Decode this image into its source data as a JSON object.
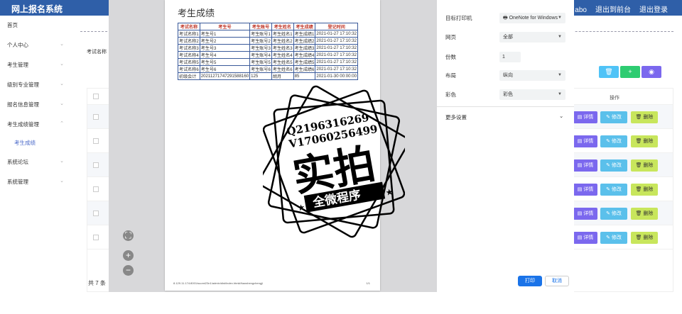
{
  "app": {
    "brand": "网上报名系统",
    "topnav": [
      "理员 abo",
      "退出到前台",
      "退出登录"
    ]
  },
  "sidebar": {
    "items": [
      {
        "label": "首页",
        "arrow": ""
      },
      {
        "label": "个人中心",
        "arrow": "⌄"
      },
      {
        "label": "考生管理",
        "arrow": "⌄"
      },
      {
        "label": "级别专业管理",
        "arrow": "⌄"
      },
      {
        "label": "报名信息管理",
        "arrow": "⌄"
      },
      {
        "label": "考生成绩管理",
        "arrow": "⌃"
      }
    ],
    "sub_item": "考生成绩",
    "items_after": [
      {
        "label": "系统论坛",
        "arrow": "⌄"
      },
      {
        "label": "系统管理",
        "arrow": "⌄"
      }
    ]
  },
  "main": {
    "filter_label": "考试名称",
    "op_header": "操作",
    "total": "共 7 条",
    "action_labels": {
      "detail": "详情",
      "edit": "修改",
      "delete": "删除"
    },
    "row_count": 7,
    "colors": {
      "detail": "#7b68ee",
      "edit": "#5bc0eb",
      "delete": "#c8e65c",
      "danger": "#4fc3f7",
      "add": "#2ecc71",
      "purple": "#7b68ee"
    }
  },
  "preview": {
    "title": "考生成绩",
    "headers": [
      "考试名称",
      "考生号",
      "考生账号",
      "考生姓名",
      "考生成绩",
      "登记时间"
    ],
    "rows": [
      [
        "考试名称1",
        "考生号1",
        "考生账号1",
        "考生姓名1",
        "考生成绩1",
        "2021-01-27 17:10:32"
      ],
      [
        "考试名称2",
        "考生号2",
        "考生账号2",
        "考生姓名2",
        "考生成绩2",
        "2021-01-27 17:10:32"
      ],
      [
        "考试名称3",
        "考生号3",
        "考生账号3",
        "考生姓名3",
        "考生成绩3",
        "2021-01-27 17:10:32"
      ],
      [
        "考试名称4",
        "考生号4",
        "考生账号4",
        "考生姓名4",
        "考生成绩4",
        "2021-01-27 17:10:32"
      ],
      [
        "考试名称5",
        "考生号5",
        "考生账号5",
        "考生姓名5",
        "考生成绩5",
        "2021-01-27 17:10:32"
      ],
      [
        "考试名称6",
        "考生号6",
        "考生账号6",
        "考生姓名6",
        "考生成绩6",
        "2021-01-27 17:10:32"
      ],
      [
        "初级会计",
        "20211271747291588160",
        "125",
        "胡月",
        "85",
        "2021-01-30 00:00:00"
      ]
    ],
    "footer_url": "8.129.11.174:8001/suomi23n1/admin/dist/index.html#/kaoshengchengji",
    "page_num": "1/1"
  },
  "print_panel": {
    "printer_label": "目标打印机",
    "printer_value": "OneNote for Windows",
    "pages_label": "网页",
    "pages_value": "全部",
    "copies_label": "份数",
    "copies_value": "1",
    "layout_label": "布局",
    "layout_value": "纵向",
    "color_label": "彩色",
    "color_value": "彩色",
    "more_label": "更多设置",
    "print_button": "打印",
    "cancel_button": "取消"
  },
  "watermark": {
    "line1": "Q2196316269",
    "line2": "V17060256499",
    "main": "实拍",
    "banner": "全微程序"
  }
}
